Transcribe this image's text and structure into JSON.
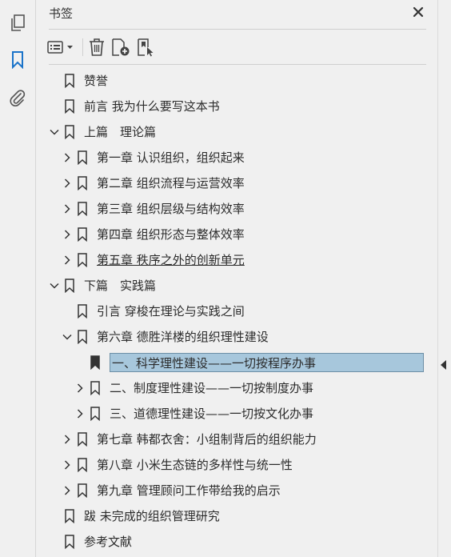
{
  "panel": {
    "title": "书签"
  },
  "sidebar": {
    "icons": [
      "pages-icon",
      "bookmark-icon",
      "attachment-icon"
    ]
  },
  "toolbar": {
    "buttons": [
      "options-menu-icon",
      "delete-icon",
      "add-bookmark-icon",
      "new-bookmark-from-structure-icon"
    ]
  },
  "bookmarks": [
    {
      "label": "赞誉",
      "level": 0,
      "expander": "none"
    },
    {
      "label": "前言 我为什么要写这本书",
      "level": 0,
      "expander": "none"
    },
    {
      "label": "上篇　理论篇",
      "level": 0,
      "expander": "expanded"
    },
    {
      "label": "第一章 认识组织，组织起来",
      "level": 1,
      "expander": "collapsed"
    },
    {
      "label": "第二章 组织流程与运营效率",
      "level": 1,
      "expander": "collapsed"
    },
    {
      "label": "第三章 组织层级与结构效率",
      "level": 1,
      "expander": "collapsed"
    },
    {
      "label": "第四章 组织形态与整体效率",
      "level": 1,
      "expander": "collapsed"
    },
    {
      "label": "第五章 秩序之外的创新单元",
      "level": 1,
      "expander": "collapsed",
      "underline": true
    },
    {
      "label": "下篇　实践篇",
      "level": 0,
      "expander": "expanded"
    },
    {
      "label": "引言 穿梭在理论与实践之间",
      "level": 1,
      "expander": "none"
    },
    {
      "label": "第六章 德胜洋楼的组织理性建设",
      "level": 1,
      "expander": "expanded"
    },
    {
      "label": "一、科学理性建设——一切按程序办事",
      "level": 2,
      "expander": "none",
      "selected": true
    },
    {
      "label": "二、制度理性建设——一切按制度办事",
      "level": 2,
      "expander": "collapsed"
    },
    {
      "label": "三、道德理性建设——一切按文化办事",
      "level": 2,
      "expander": "collapsed"
    },
    {
      "label": "第七章 韩都衣舍：小组制背后的组织能力",
      "level": 1,
      "expander": "collapsed"
    },
    {
      "label": "第八章 小米生态链的多样性与统一性",
      "level": 1,
      "expander": "collapsed"
    },
    {
      "label": "第九章 管理顾问工作带给我的启示",
      "level": 1,
      "expander": "collapsed"
    },
    {
      "label": "跋 未完成的组织管理研究",
      "level": 0,
      "expander": "none"
    },
    {
      "label": "参考文献",
      "level": 0,
      "expander": "none"
    }
  ],
  "colors": {
    "selection": "#a7c7dc",
    "accent": "#1a73c9"
  }
}
